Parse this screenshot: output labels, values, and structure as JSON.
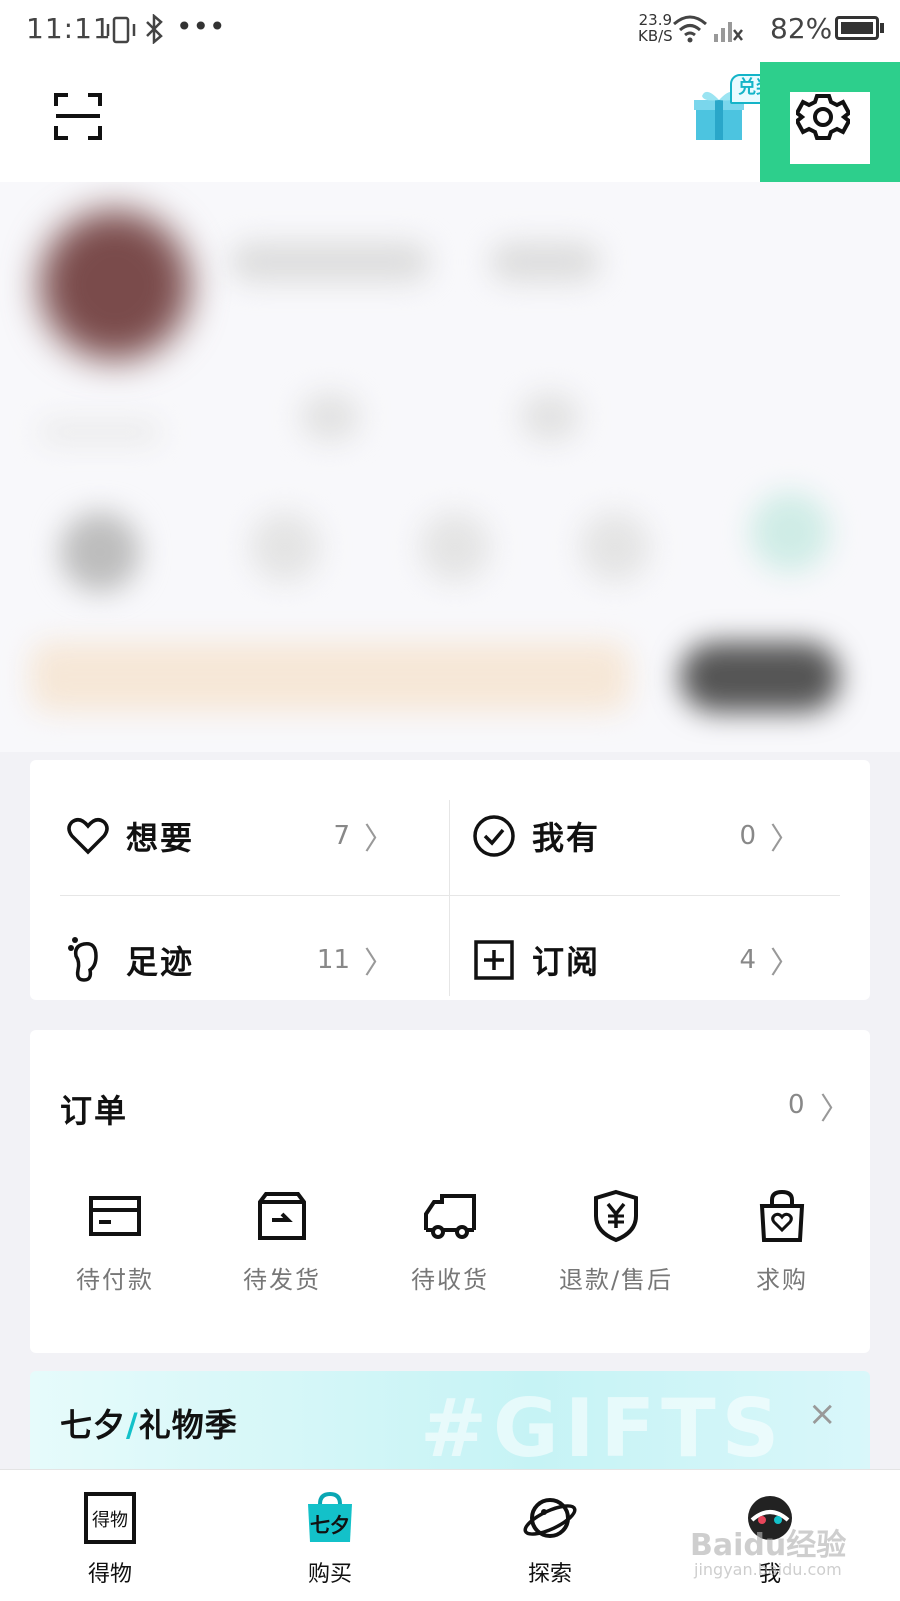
{
  "status_bar": {
    "time": "11:11",
    "net_speed_value": "23.9",
    "net_speed_unit": "KB/S",
    "battery": "82%"
  },
  "header": {
    "scan_icon": "scan-icon",
    "gift_badge": "兑奖",
    "settings_icon": "gear-icon",
    "highlight_color": "#2dcf8c"
  },
  "quick": {
    "want": {
      "label": "想要",
      "count": "7"
    },
    "have": {
      "label": "我有",
      "count": "0"
    },
    "footprint": {
      "label": "足迹",
      "count": "11"
    },
    "subscribe": {
      "label": "订阅",
      "count": "4"
    }
  },
  "orders": {
    "title": "订单",
    "count": "0",
    "items": [
      {
        "label": "待付款",
        "icon": "card-icon"
      },
      {
        "label": "待发货",
        "icon": "box-icon"
      },
      {
        "label": "待收货",
        "icon": "truck-icon"
      },
      {
        "label": "退款/售后",
        "icon": "shield-yen-icon"
      },
      {
        "label": "求购",
        "icon": "bag-heart-icon"
      }
    ]
  },
  "banner": {
    "title_part1": "七夕",
    "slash": "/",
    "title_part2": "礼物季",
    "bg_text": "#GIFTS",
    "close": "×"
  },
  "tabbar": {
    "items": [
      {
        "label": "得物",
        "icon": "dewu-logo-icon"
      },
      {
        "label": "购买",
        "icon": "shopping-bag-icon"
      },
      {
        "label": "探索",
        "icon": "planet-icon"
      },
      {
        "label": "我",
        "icon": "avatar-icon"
      }
    ]
  },
  "watermark": {
    "line1": "Baidu经验",
    "line2": "jingyan.baidu.com"
  },
  "colors": {
    "accent": "#2dcf8c",
    "teal": "#13c1c9"
  }
}
